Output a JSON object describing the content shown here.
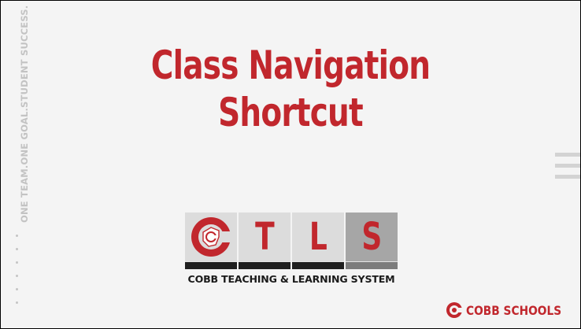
{
  "slide": {
    "title_lines": [
      "Class Navigation",
      "Shortcut"
    ],
    "tagline": "ONE TEAM.ONE GOAL.STUDENT SUCCESS.",
    "logo": {
      "letters": [
        "T",
        "L",
        "S"
      ],
      "subtitle": "COBB TEACHING & LEARNING SYSTEM",
      "emblem_icon": "cobb-c-emblem-icon"
    },
    "brand": {
      "label": "COBB SCHOOLS",
      "icon": "cobb-c-emblem-icon"
    },
    "menu_icon": "hamburger-icon",
    "colors": {
      "accent": "#c1272d",
      "background": "#f4f4f4",
      "muted": "#c3c3c3"
    }
  }
}
